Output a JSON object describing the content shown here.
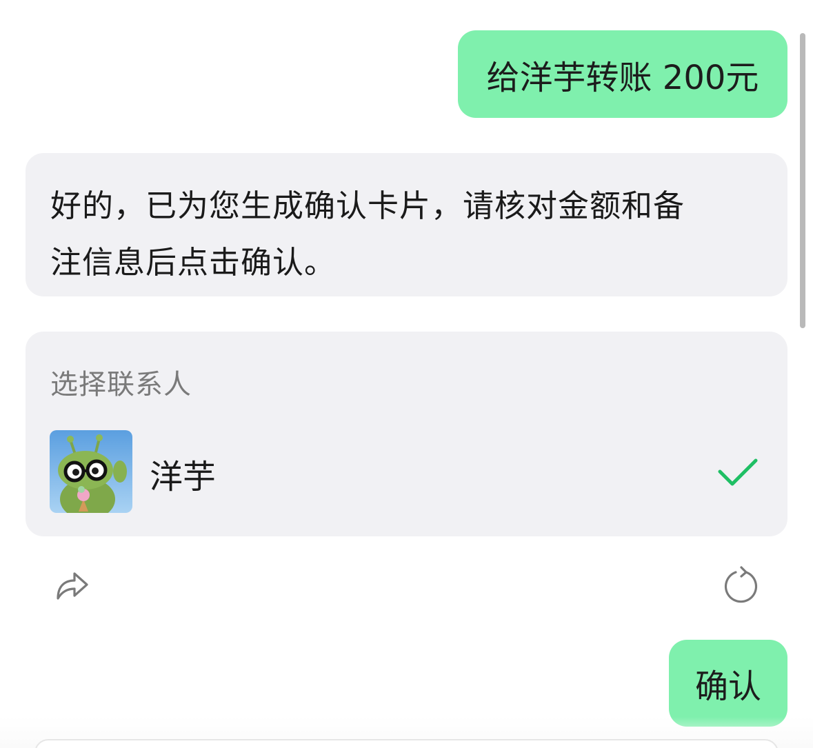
{
  "conversation": {
    "user_message_1": "给洋芋转账 200元",
    "ai_reply_line_1": "好的，已为您生成确认卡片，请核对金额和备",
    "ai_reply_line_2": "注信息后点击确认。",
    "user_message_2": "确认"
  },
  "contact_card": {
    "title": "选择联系人",
    "selected_contact": {
      "name": "洋芋",
      "avatar_icon": "green-alien-avatar",
      "selected": true
    },
    "check_icon": "checkmark-icon",
    "check_color": "#1fbf64"
  },
  "actions": {
    "share_icon": "share-icon",
    "refresh_icon": "refresh-icon"
  },
  "colors": {
    "user_bubble": "#7ff0ad",
    "ai_bubble": "#f1f1f4",
    "accent_green": "#1fbf64"
  }
}
